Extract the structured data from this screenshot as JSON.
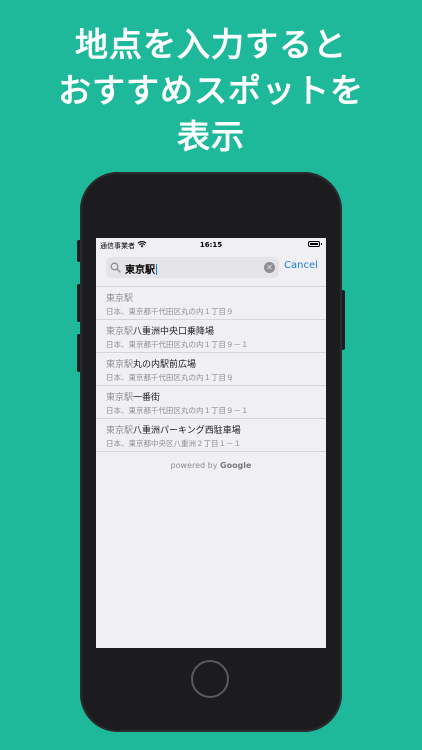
{
  "headline": {
    "line1": "地点を入力すると",
    "line2": "おすすめスポットを",
    "line3": "表示"
  },
  "status_bar": {
    "carrier": "通信事業者",
    "time": "16:15"
  },
  "search": {
    "value": "東京駅",
    "cancel_label": "Cancel"
  },
  "results": [
    {
      "title_muted": "東京駅",
      "title_main": "",
      "address": "日本、東京都千代田区丸の内１丁目９"
    },
    {
      "title_muted": "東京駅",
      "title_main": "八重洲中央口乗降場",
      "address": "日本、東京都千代田区丸の内１丁目９－１"
    },
    {
      "title_muted": "東京駅",
      "title_main": "丸の内駅前広場",
      "address": "日本、東京都千代田区丸の内１丁目９"
    },
    {
      "title_muted": "東京駅",
      "title_main": "一番街",
      "address": "日本、東京都千代田区丸の内１丁目９－１"
    },
    {
      "title_muted": "東京駅",
      "title_main": "八重洲パーキング西駐車場",
      "address": "日本、東京都中央区八重洲２丁目１－１"
    }
  ],
  "attribution": {
    "prefix": "powered by",
    "brand": "Google"
  },
  "colors": {
    "background": "#1eb89a",
    "accent": "#1a7fe0"
  }
}
